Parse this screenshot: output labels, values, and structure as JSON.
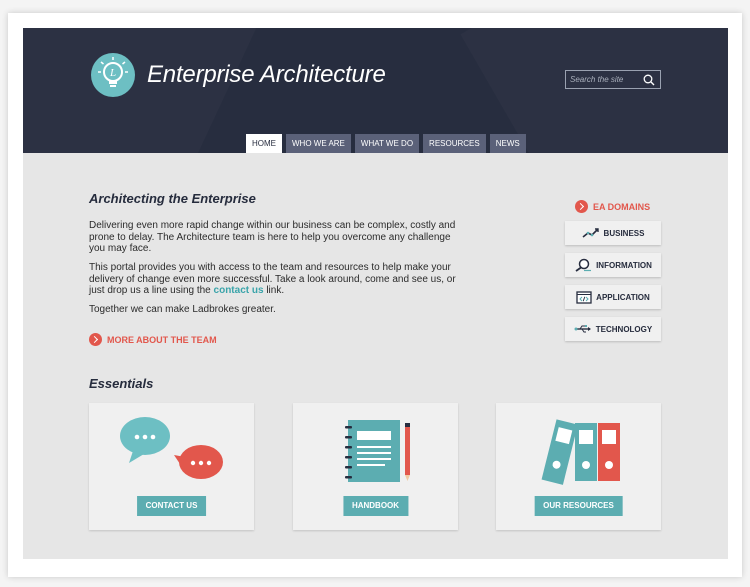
{
  "site": {
    "title": "Enterprise Architecture",
    "logo_letter": "L"
  },
  "search": {
    "placeholder": "Search the site",
    "icon": "search-icon"
  },
  "nav": {
    "tabs": [
      {
        "label": "HOME",
        "active": true
      },
      {
        "label": "WHO WE ARE",
        "active": false
      },
      {
        "label": "WHAT WE DO",
        "active": false
      },
      {
        "label": "RESOURCES",
        "active": false
      },
      {
        "label": "NEWS",
        "active": false
      }
    ]
  },
  "main": {
    "heading": "Architecting the Enterprise",
    "para1": "Delivering even more rapid change within our business can be complex, costly and prone to delay. The Architecture team is here to help you overcome any challenge you may face.",
    "para2_before": "This portal provides you with access to the team and resources to help make your delivery of change even more successful. Take a look around, come and see us, or just drop us a line using the ",
    "para2_link": "contact us",
    "para2_after": " link.",
    "para3": "Together we can make Ladbrokes greater.",
    "more_link": "MORE ABOUT THE TEAM"
  },
  "essentials": {
    "heading": "Essentials",
    "cards": [
      {
        "button": "CONTACT US",
        "icon": "chat-bubbles-icon"
      },
      {
        "button": "HANDBOOK",
        "icon": "notebook-icon"
      },
      {
        "button": "OUR RESOURCES",
        "icon": "binders-icon"
      }
    ]
  },
  "ea_domains": {
    "heading": "EA DOMAINS",
    "items": [
      {
        "label": "BUSINESS",
        "icon": "trend-chart-icon"
      },
      {
        "label": "INFORMATION",
        "icon": "magnifier-icon"
      },
      {
        "label": "APPLICATION",
        "icon": "code-window-icon"
      },
      {
        "label": "TECHNOLOGY",
        "icon": "usb-icon"
      }
    ]
  },
  "colors": {
    "header_bg": "#272d3f",
    "accent_teal": "#5cadb1",
    "accent_red": "#e2574c",
    "nav_tab": "#5b6179"
  }
}
